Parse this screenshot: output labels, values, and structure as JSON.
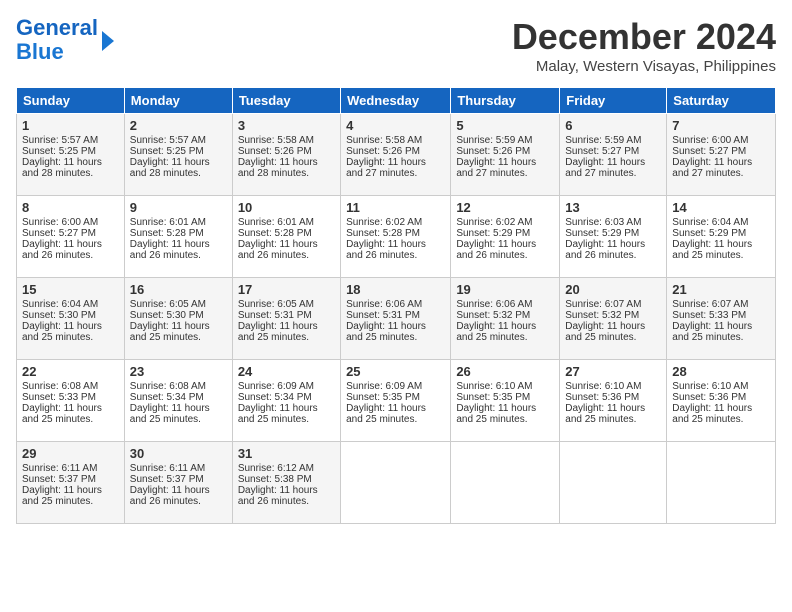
{
  "header": {
    "logo_line1": "General",
    "logo_line2": "Blue",
    "month": "December 2024",
    "location": "Malay, Western Visayas, Philippines"
  },
  "weekdays": [
    "Sunday",
    "Monday",
    "Tuesday",
    "Wednesday",
    "Thursday",
    "Friday",
    "Saturday"
  ],
  "weeks": [
    [
      {
        "day": "1",
        "sunrise": "5:57 AM",
        "sunset": "5:25 PM",
        "daylight": "11 hours and 28 minutes."
      },
      {
        "day": "2",
        "sunrise": "5:57 AM",
        "sunset": "5:25 PM",
        "daylight": "11 hours and 28 minutes."
      },
      {
        "day": "3",
        "sunrise": "5:58 AM",
        "sunset": "5:26 PM",
        "daylight": "11 hours and 28 minutes."
      },
      {
        "day": "4",
        "sunrise": "5:58 AM",
        "sunset": "5:26 PM",
        "daylight": "11 hours and 27 minutes."
      },
      {
        "day": "5",
        "sunrise": "5:59 AM",
        "sunset": "5:26 PM",
        "daylight": "11 hours and 27 minutes."
      },
      {
        "day": "6",
        "sunrise": "5:59 AM",
        "sunset": "5:27 PM",
        "daylight": "11 hours and 27 minutes."
      },
      {
        "day": "7",
        "sunrise": "6:00 AM",
        "sunset": "5:27 PM",
        "daylight": "11 hours and 27 minutes."
      }
    ],
    [
      {
        "day": "8",
        "sunrise": "6:00 AM",
        "sunset": "5:27 PM",
        "daylight": "11 hours and 26 minutes."
      },
      {
        "day": "9",
        "sunrise": "6:01 AM",
        "sunset": "5:28 PM",
        "daylight": "11 hours and 26 minutes."
      },
      {
        "day": "10",
        "sunrise": "6:01 AM",
        "sunset": "5:28 PM",
        "daylight": "11 hours and 26 minutes."
      },
      {
        "day": "11",
        "sunrise": "6:02 AM",
        "sunset": "5:28 PM",
        "daylight": "11 hours and 26 minutes."
      },
      {
        "day": "12",
        "sunrise": "6:02 AM",
        "sunset": "5:29 PM",
        "daylight": "11 hours and 26 minutes."
      },
      {
        "day": "13",
        "sunrise": "6:03 AM",
        "sunset": "5:29 PM",
        "daylight": "11 hours and 26 minutes."
      },
      {
        "day": "14",
        "sunrise": "6:04 AM",
        "sunset": "5:29 PM",
        "daylight": "11 hours and 25 minutes."
      }
    ],
    [
      {
        "day": "15",
        "sunrise": "6:04 AM",
        "sunset": "5:30 PM",
        "daylight": "11 hours and 25 minutes."
      },
      {
        "day": "16",
        "sunrise": "6:05 AM",
        "sunset": "5:30 PM",
        "daylight": "11 hours and 25 minutes."
      },
      {
        "day": "17",
        "sunrise": "6:05 AM",
        "sunset": "5:31 PM",
        "daylight": "11 hours and 25 minutes."
      },
      {
        "day": "18",
        "sunrise": "6:06 AM",
        "sunset": "5:31 PM",
        "daylight": "11 hours and 25 minutes."
      },
      {
        "day": "19",
        "sunrise": "6:06 AM",
        "sunset": "5:32 PM",
        "daylight": "11 hours and 25 minutes."
      },
      {
        "day": "20",
        "sunrise": "6:07 AM",
        "sunset": "5:32 PM",
        "daylight": "11 hours and 25 minutes."
      },
      {
        "day": "21",
        "sunrise": "6:07 AM",
        "sunset": "5:33 PM",
        "daylight": "11 hours and 25 minutes."
      }
    ],
    [
      {
        "day": "22",
        "sunrise": "6:08 AM",
        "sunset": "5:33 PM",
        "daylight": "11 hours and 25 minutes."
      },
      {
        "day": "23",
        "sunrise": "6:08 AM",
        "sunset": "5:34 PM",
        "daylight": "11 hours and 25 minutes."
      },
      {
        "day": "24",
        "sunrise": "6:09 AM",
        "sunset": "5:34 PM",
        "daylight": "11 hours and 25 minutes."
      },
      {
        "day": "25",
        "sunrise": "6:09 AM",
        "sunset": "5:35 PM",
        "daylight": "11 hours and 25 minutes."
      },
      {
        "day": "26",
        "sunrise": "6:10 AM",
        "sunset": "5:35 PM",
        "daylight": "11 hours and 25 minutes."
      },
      {
        "day": "27",
        "sunrise": "6:10 AM",
        "sunset": "5:36 PM",
        "daylight": "11 hours and 25 minutes."
      },
      {
        "day": "28",
        "sunrise": "6:10 AM",
        "sunset": "5:36 PM",
        "daylight": "11 hours and 25 minutes."
      }
    ],
    [
      {
        "day": "29",
        "sunrise": "6:11 AM",
        "sunset": "5:37 PM",
        "daylight": "11 hours and 25 minutes."
      },
      {
        "day": "30",
        "sunrise": "6:11 AM",
        "sunset": "5:37 PM",
        "daylight": "11 hours and 26 minutes."
      },
      {
        "day": "31",
        "sunrise": "6:12 AM",
        "sunset": "5:38 PM",
        "daylight": "11 hours and 26 minutes."
      },
      null,
      null,
      null,
      null
    ]
  ]
}
